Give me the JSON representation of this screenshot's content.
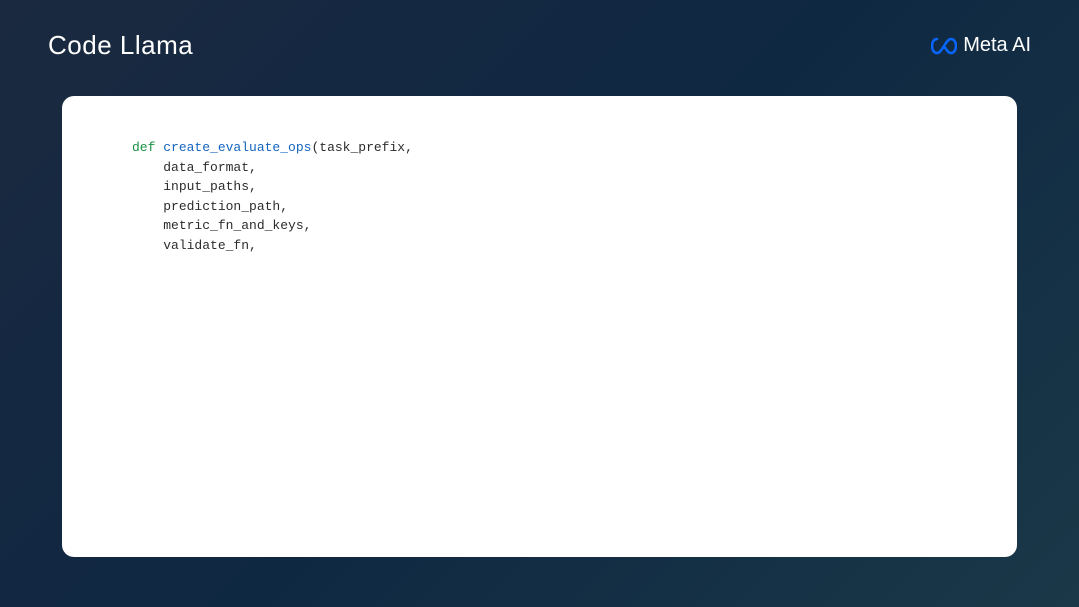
{
  "header": {
    "title": "Code Llama",
    "brand": "Meta AI"
  },
  "code": {
    "keyword": "def ",
    "function_name": "create_evaluate_ops",
    "open_paren": "(",
    "params": [
      "task_prefix,",
      "data_format,",
      "input_paths,",
      "prediction_path,",
      "metric_fn_and_keys,",
      "validate_fn,"
    ]
  },
  "colors": {
    "keyword": "#1a9146",
    "function": "#1565c0",
    "text": "#2c2c2c",
    "bg_gradient_start": "#1a2940",
    "bg_gradient_end": "#1a3848",
    "panel_bg": "#ffffff",
    "logo_accent": "#0866ff"
  }
}
